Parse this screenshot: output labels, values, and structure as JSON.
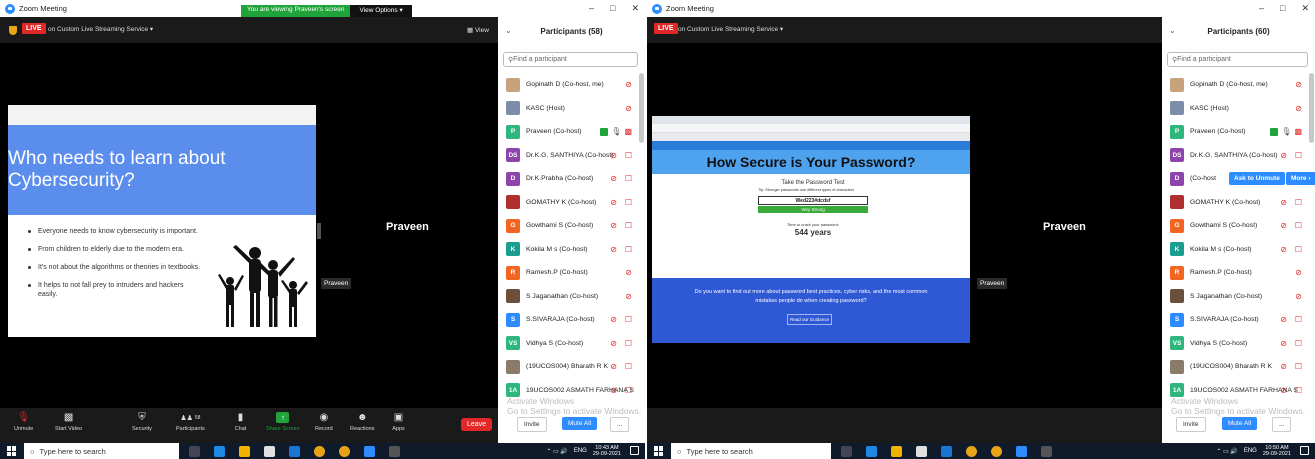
{
  "left": {
    "window_title": "Zoom Meeting",
    "viewing_banner": "You are viewing Praveen's screen",
    "view_options": "View Options ▾",
    "live_badge": "LIVE",
    "stream_label": "on Custom Live Streaming Service ▾",
    "view_button": "View",
    "slide": {
      "title": "Who needs to learn about Cybersecurity?",
      "bullets": [
        "Everyone needs to know cybersecurity is important.",
        "From children to elderly due to the modern era.",
        "It's not about the algorithms or theories in textbooks.",
        "It helps to not fall prey to intruders and hackers easily."
      ]
    },
    "presenter_name": "Praveen",
    "presenter_small": "Praveen",
    "toolbar": {
      "unmute": "Unmute",
      "start_video": "Start Video",
      "security": "Security",
      "participants": "Participants",
      "participants_count": "58",
      "chat": "Chat",
      "share_screen": "Share Screen",
      "record": "Record",
      "reactions": "Reactions",
      "apps": "Apps",
      "leave": "Leave"
    },
    "panel": {
      "title": "Participants (58)",
      "search_placeholder": "Find a participant",
      "invite": "Invite",
      "mute_all": "Mute All",
      "more": "...",
      "participants": [
        {
          "name": "Gopinath D (Co-host, me)",
          "initials": "",
          "color": "#c8a27a",
          "mic": "muted",
          "video": "none"
        },
        {
          "name": "KASC (Host)",
          "initials": "",
          "color": "#7b8da8",
          "mic": "muted",
          "video": "none"
        },
        {
          "name": "Praveen (Co-host)",
          "initials": "P",
          "color": "#2eb67d",
          "mic": "on",
          "video": "off"
        },
        {
          "name": "Dr.K.G. SANTHIYA (Co-host)",
          "initials": "DS",
          "color": "#8e44ad",
          "mic": "muted",
          "video": "off"
        },
        {
          "name": "Dr.K.Prabha (Co-host)",
          "initials": "D",
          "color": "#8e44ad",
          "mic": "muted",
          "video": "off"
        },
        {
          "name": "GOMATHY K (Co-host)",
          "initials": "",
          "color": "#b03030",
          "mic": "muted",
          "video": "off"
        },
        {
          "name": "Gowthami S (Co-host)",
          "initials": "G",
          "color": "#f26522",
          "mic": "muted",
          "video": "off"
        },
        {
          "name": "Kokila M s (Co-host)",
          "initials": "K",
          "color": "#1a9e8f",
          "mic": "muted",
          "video": "off"
        },
        {
          "name": "Ramesh.P (Co-host)",
          "initials": "R",
          "color": "#f26522",
          "mic": "muted",
          "video": "none"
        },
        {
          "name": "S Jaganathan (Co-host)",
          "initials": "",
          "color": "#6b4f3a",
          "mic": "muted",
          "video": "none"
        },
        {
          "name": "S.SIVARAJA (Co-host)",
          "initials": "S",
          "color": "#2d8cff",
          "mic": "muted",
          "video": "off"
        },
        {
          "name": "Vidhya S (Co-host)",
          "initials": "VS",
          "color": "#2eb67d",
          "mic": "muted",
          "video": "off"
        },
        {
          "name": "(19UCOS004) Bharath R K",
          "initials": "",
          "color": "#8a7a6a",
          "mic": "muted",
          "video": "off"
        },
        {
          "name": "19UCOS002 ASMATH FARHANA S",
          "initials": "1A",
          "color": "#2eb67d",
          "mic": "muted",
          "video": "off"
        }
      ]
    },
    "watermark_line1": "Activate Windows",
    "watermark_line2": "Go to Settings to activate Windows.",
    "taskbar": {
      "search": "Type here to search",
      "lang": "ENG",
      "time": "10:43 AM",
      "date": "29-09-2021"
    }
  },
  "right": {
    "window_title": "Zoom Meeting",
    "live_badge": "LIVE",
    "stream_label": "on Custom Live Streaming Service ▾",
    "browser": {
      "hero": "How Secure is Your Password?",
      "test_title": "Take the Password Test",
      "tip": "Tip: Stronger passwords use different types of characters",
      "password": "Wed223#dcdsf",
      "strength": "Very Strong",
      "crack_label": "Time to crack your password:",
      "years": "544 years",
      "footer": "Do you want to find out more about password best practices, cyber risks, and the most common mistakes people do when creating password?",
      "footer_btn": "Read our Guidance"
    },
    "presenter_name": "Praveen",
    "presenter_small": "Praveen",
    "panel": {
      "title": "Participants (60)",
      "search_placeholder": "Find a participant",
      "ask_unmute": "Ask to Unmute",
      "more_btn": "More ›",
      "invite": "Invite",
      "mute_all": "Mute All",
      "more": "...",
      "participants": [
        {
          "name": "Gopinath D (Co-host, me)",
          "initials": "",
          "color": "#c8a27a",
          "mic": "muted",
          "video": "none"
        },
        {
          "name": "KASC (Host)",
          "initials": "",
          "color": "#7b8da8",
          "mic": "muted",
          "video": "none"
        },
        {
          "name": "Praveen (Co-host)",
          "initials": "P",
          "color": "#2eb67d",
          "mic": "on",
          "video": "off"
        },
        {
          "name": "Dr.K.G. SANTHIYA (Co-host)",
          "initials": "DS",
          "color": "#8e44ad",
          "mic": "muted",
          "video": "off"
        },
        {
          "name": "(Co-host",
          "initials": "D",
          "color": "#8e44ad",
          "mic": "muted",
          "video": "hover"
        },
        {
          "name": "GOMATHY K (Co-host)",
          "initials": "",
          "color": "#b03030",
          "mic": "muted",
          "video": "off"
        },
        {
          "name": "Gowthami S (Co-host)",
          "initials": "G",
          "color": "#f26522",
          "mic": "muted",
          "video": "off"
        },
        {
          "name": "Kokila M s (Co-host)",
          "initials": "K",
          "color": "#1a9e8f",
          "mic": "muted",
          "video": "off"
        },
        {
          "name": "Ramesh.P (Co-host)",
          "initials": "R",
          "color": "#f26522",
          "mic": "muted",
          "video": "none"
        },
        {
          "name": "S Jaganathan (Co-host)",
          "initials": "",
          "color": "#6b4f3a",
          "mic": "muted",
          "video": "none"
        },
        {
          "name": "S.SIVARAJA (Co-host)",
          "initials": "S",
          "color": "#2d8cff",
          "mic": "muted",
          "video": "off"
        },
        {
          "name": "Vidhya S (Co-host)",
          "initials": "VS",
          "color": "#2eb67d",
          "mic": "muted",
          "video": "off"
        },
        {
          "name": "(19UCOS004) Bharath R K",
          "initials": "",
          "color": "#8a7a6a",
          "mic": "muted",
          "video": "off"
        },
        {
          "name": "19UCOS002 ASMATH FARHANA S",
          "initials": "1A",
          "color": "#2eb67d",
          "mic": "muted",
          "video": "off"
        }
      ]
    },
    "watermark_line1": "Activate Windows",
    "watermark_line2": "Go to Settings to activate Windows.",
    "taskbar": {
      "search": "Type here to search",
      "lang": "ENG",
      "time": "10:50 AM",
      "date": "29-09-2021"
    }
  },
  "colors": {
    "live": "#e02828",
    "zoom_blue": "#2d8cff",
    "green": "#1fa33a"
  },
  "icons": [
    "zoom-logo-icon",
    "shield-icon",
    "mic-muted-icon",
    "video-off-icon",
    "security-icon",
    "participants-icon",
    "chat-icon",
    "share-screen-icon",
    "record-icon",
    "reactions-icon",
    "apps-icon",
    "windows-start-icon",
    "search-icon"
  ]
}
